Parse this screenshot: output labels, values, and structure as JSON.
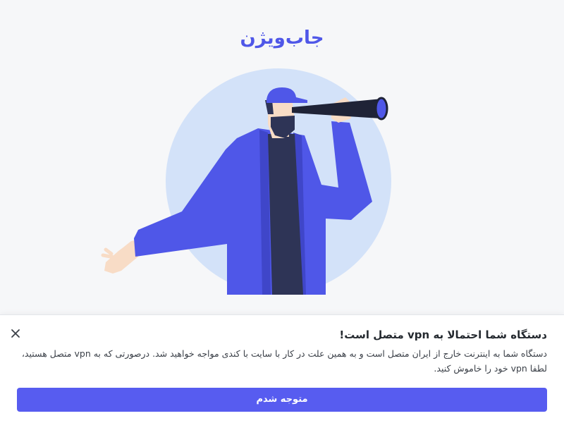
{
  "brand": {
    "logo_text": "جاب‌ویژن",
    "color": "#4f57e8"
  },
  "illustration": {
    "subject": "man-with-telescope",
    "circle_color": "#d3e2f9",
    "jacket_color": "#4f57e8",
    "shirt_color": "#2e3456"
  },
  "dialog": {
    "title": "دستگاه شما احتمالا به vpn متصل است!",
    "body": "دستگاه شما به اینترنت خارج از ایران متصل است و به همین علت در کار با سایت با کندی مواجه خواهید شد. درصورتی که به vpn متصل هستید، لطفا vpn خود را خاموش کنید.",
    "confirm_label": "متوجه شدم",
    "close_icon": "close-icon",
    "button_color": "#575cf0"
  }
}
